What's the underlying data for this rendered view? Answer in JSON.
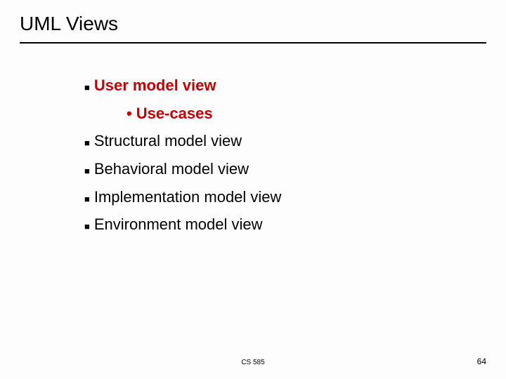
{
  "title": "UML Views",
  "items": [
    {
      "label": "User model view",
      "highlighted": true,
      "sub": {
        "label": "Use-cases"
      }
    },
    {
      "label": "Structural model view",
      "highlighted": false
    },
    {
      "label": "Behavioral model view",
      "highlighted": false
    },
    {
      "label": "Implementation model view",
      "highlighted": false
    },
    {
      "label": "Environment model view",
      "highlighted": false
    }
  ],
  "footer": "CS 585",
  "page": "64"
}
